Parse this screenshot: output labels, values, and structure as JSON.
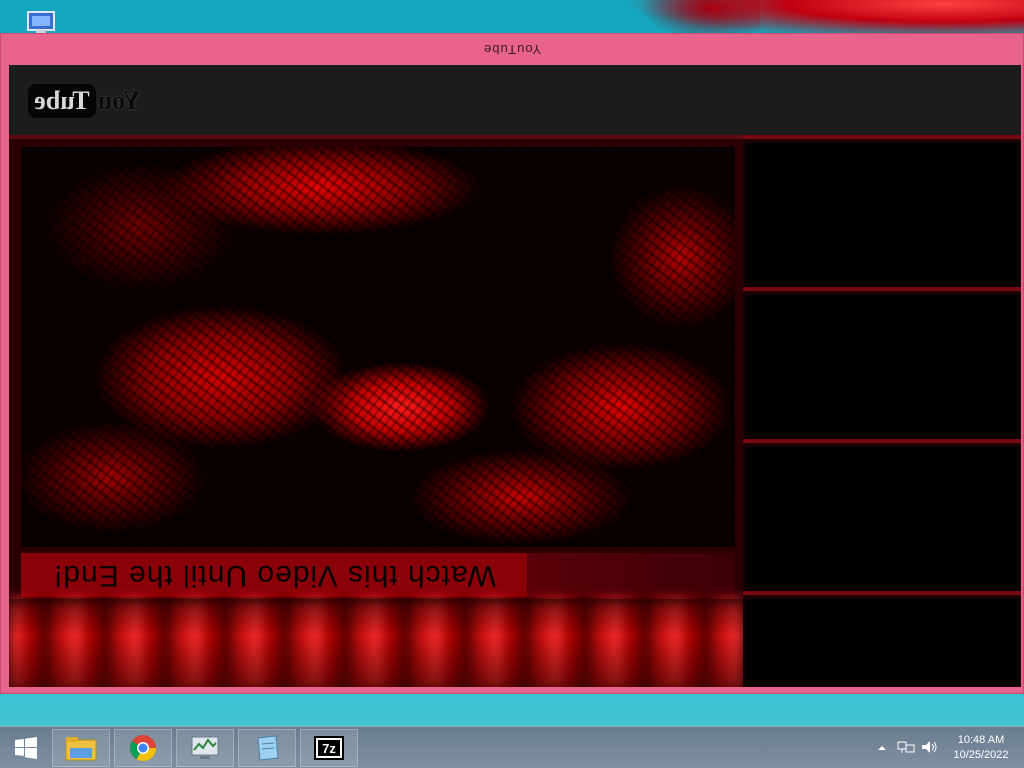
{
  "window": {
    "title": "YouTube"
  },
  "youtube": {
    "logo_you": "You",
    "logo_tube": "Tube"
  },
  "video": {
    "caption": "Watch this Video Until the End!"
  },
  "sidebar": {
    "items": [
      {
        "id": "related-1"
      },
      {
        "id": "related-2"
      },
      {
        "id": "related-3"
      },
      {
        "id": "related-4"
      }
    ]
  },
  "taskbar": {
    "apps": [
      {
        "name": "file-explorer-icon"
      },
      {
        "name": "chrome-icon"
      },
      {
        "name": "task-manager-icon"
      },
      {
        "name": "notepad-icon"
      },
      {
        "name": "7zip-icon",
        "label": "7z"
      }
    ],
    "time": "10:48 AM",
    "date": "10/25/2022"
  },
  "colors": {
    "window_border": "#e8648c",
    "video_red": "#d40000",
    "caption_bg": "#8a0008"
  }
}
